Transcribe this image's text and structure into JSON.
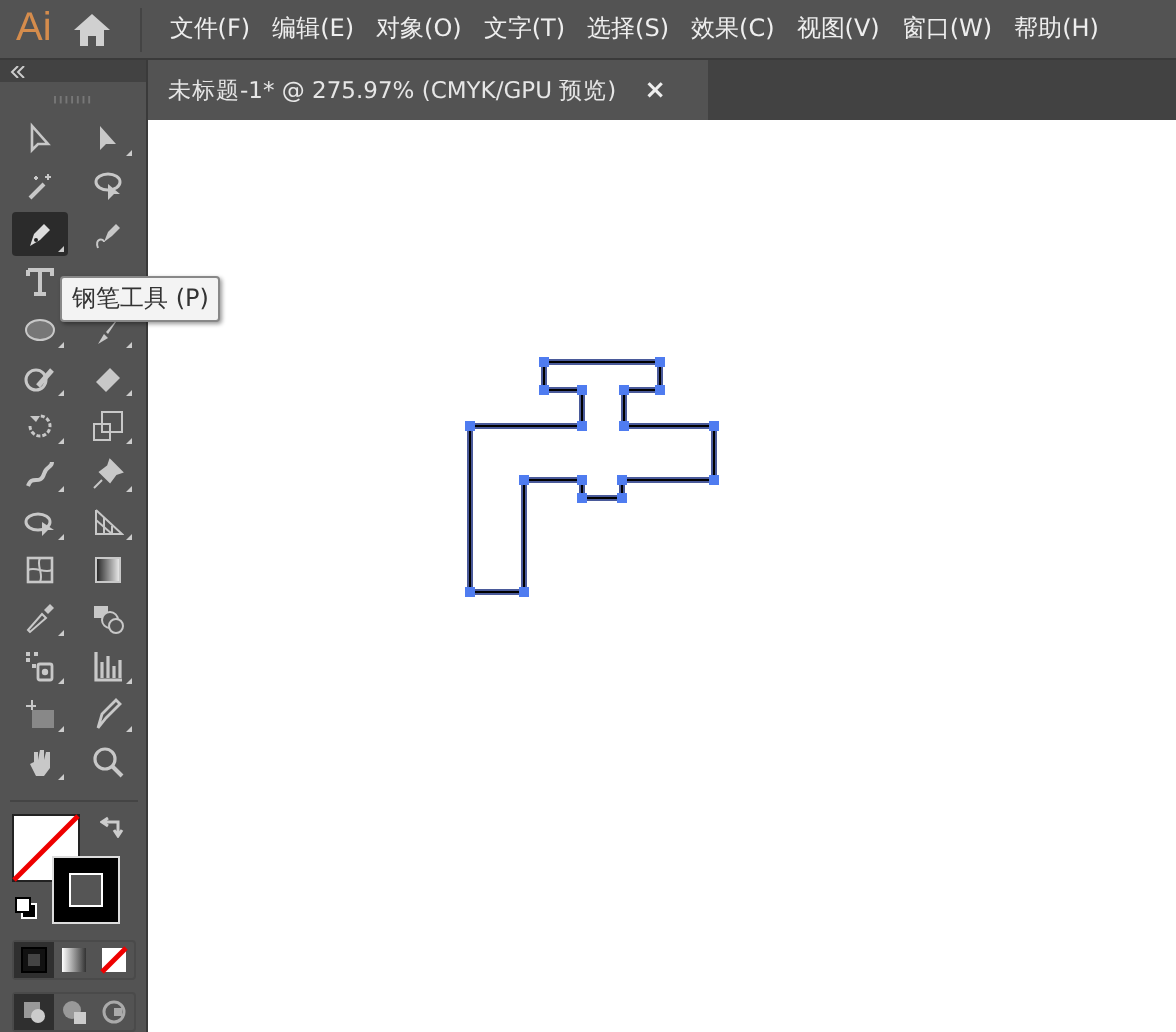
{
  "app": {
    "logo": "Ai"
  },
  "menus": [
    "文件(F)",
    "编辑(E)",
    "对象(O)",
    "文字(T)",
    "选择(S)",
    "效果(C)",
    "视图(V)",
    "窗口(W)",
    "帮助(H)"
  ],
  "document_tab": {
    "title": "未标题-1* @ 275.97% (CMYK/GPU 预览)",
    "close": "×",
    "selected": true
  },
  "tool_rows": [
    [
      {
        "kind": "selection",
        "selected": false
      },
      {
        "kind": "direct-selection",
        "selected": false
      }
    ],
    [
      {
        "kind": "magic-wand",
        "selected": false
      },
      {
        "kind": "lasso",
        "selected": false
      }
    ],
    [
      {
        "kind": "pen",
        "selected": true
      },
      {
        "kind": "curvature",
        "selected": false
      }
    ],
    [
      {
        "kind": "type",
        "selected": false
      }
    ],
    [
      {
        "kind": "ellipse",
        "selected": false
      },
      {
        "kind": "paintbrush",
        "selected": false
      }
    ],
    [
      {
        "kind": "shaper",
        "selected": false
      },
      {
        "kind": "eraser",
        "selected": false
      }
    ],
    [
      {
        "kind": "rotate",
        "selected": false
      },
      {
        "kind": "scale",
        "selected": false
      }
    ],
    [
      {
        "kind": "puppet",
        "selected": false
      },
      {
        "kind": "pin",
        "selected": false
      }
    ],
    [
      {
        "kind": "free-transform",
        "selected": false
      },
      {
        "kind": "perspective",
        "selected": false
      }
    ],
    [
      {
        "kind": "mesh",
        "selected": false
      },
      {
        "kind": "gradient",
        "selected": false
      }
    ],
    [
      {
        "kind": "eyedropper",
        "selected": false
      },
      {
        "kind": "blend",
        "selected": false
      }
    ],
    [
      {
        "kind": "sprayer",
        "selected": false
      },
      {
        "kind": "graph",
        "selected": false
      }
    ],
    [
      {
        "kind": "artboard",
        "selected": false
      },
      {
        "kind": "slice",
        "selected": false
      }
    ],
    [
      {
        "kind": "hand",
        "selected": false
      },
      {
        "kind": "zoom",
        "selected": false
      }
    ]
  ],
  "tooltip": {
    "text": "钢笔工具 (P)"
  },
  "color_modes": [
    {
      "kind": "color",
      "selected": true
    },
    {
      "kind": "gradient",
      "selected": false
    },
    {
      "kind": "none",
      "selected": false
    }
  ],
  "draw_modes": [
    {
      "kind": "normal",
      "selected": true
    },
    {
      "kind": "behind",
      "selected": false
    },
    {
      "kind": "inside",
      "selected": false
    }
  ]
}
